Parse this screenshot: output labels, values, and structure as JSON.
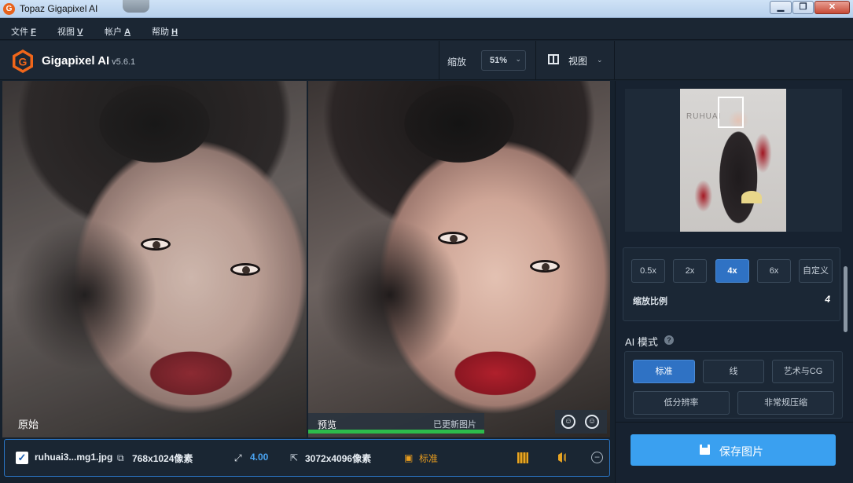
{
  "window": {
    "title": "Topaz Gigapixel AI",
    "app_icon": "G",
    "min": "▁",
    "max": "❐",
    "close": "✕"
  },
  "menu": [
    {
      "label": "文件",
      "key": "F"
    },
    {
      "label": "视图",
      "key": "V"
    },
    {
      "label": "帐户",
      "key": "A"
    },
    {
      "label": "帮助",
      "key": "H"
    }
  ],
  "header": {
    "brand": "Gigapixel AI",
    "version": "v5.6.1",
    "zoom_label": "缩放",
    "zoom_value": "51%",
    "view_label": "视图"
  },
  "panes": {
    "original_label": "原始",
    "preview_label": "预览",
    "preview_status": "已更新图片",
    "preview_progress": 1.0
  },
  "bottom": {
    "checked": true,
    "filename": "ruhuai3...mg1.jpg",
    "input_size": "768x1024像素",
    "scale": "4.00",
    "output_size": "3072x4096像素",
    "mode": "标准"
  },
  "right": {
    "thumb_watermark": "RUHUAI",
    "scale_buttons": [
      "0.5x",
      "2x",
      "4x",
      "6x",
      "自定义"
    ],
    "active_scale": "4x",
    "scale_label": "缩放比例",
    "scale_value": "4",
    "ai_mode_title": "AI 模式",
    "ai_buttons_row1": [
      "标准",
      "线",
      "艺术与CG"
    ],
    "ai_buttons_row2": [
      "低分辨率",
      "非常规压缩"
    ],
    "active_ai": "标准",
    "save_label": "保存图片"
  },
  "colors": {
    "accent": "#3aa0f0",
    "active": "#2f72c4",
    "progress": "#2dbb4b",
    "lips": "#b0202c"
  }
}
